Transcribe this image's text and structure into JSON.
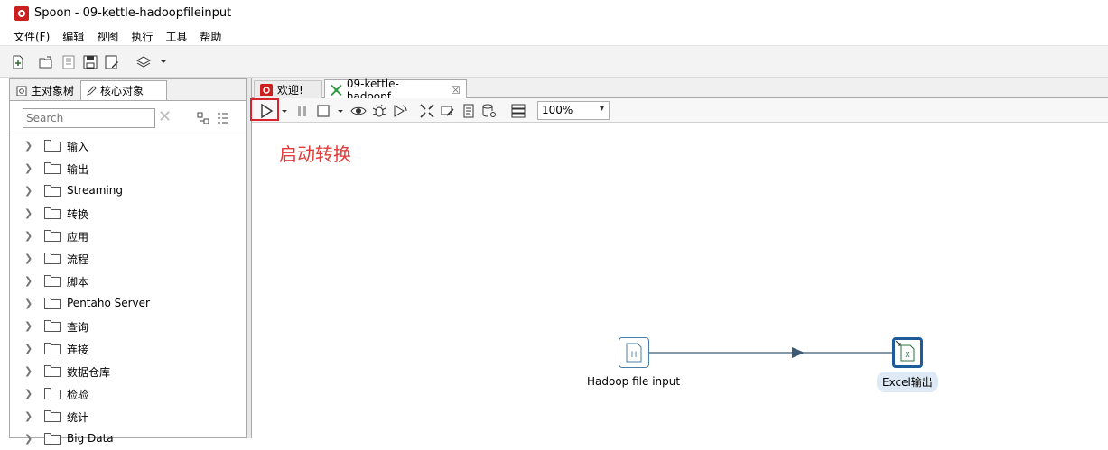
{
  "window": {
    "title": "Spoon - 09-kettle-hadoopfileinput"
  },
  "menu": [
    "文件(F)",
    "编辑",
    "视图",
    "执行",
    "工具",
    "帮助"
  ],
  "left_panel": {
    "tabs": [
      {
        "label": "主对象树",
        "icon": "search-icon"
      },
      {
        "label": "核心对象",
        "icon": "pencil-icon"
      }
    ],
    "search_placeholder": "Search",
    "tree": [
      "输入",
      "输出",
      "Streaming",
      "转换",
      "应用",
      "流程",
      "脚本",
      "Pentaho Server",
      "查询",
      "连接",
      "数据仓库",
      "检验",
      "统计",
      "Big Data"
    ]
  },
  "editor": {
    "tabs": [
      {
        "label": "欢迎!",
        "icon": "spoon-icon"
      },
      {
        "label": "09-kettle-hadoopf...",
        "icon": "transformation-icon",
        "close": "☒"
      }
    ],
    "zoom": "100%",
    "annotation": "启动转换",
    "steps": [
      {
        "name": "Hadoop file input",
        "glyph": "H"
      },
      {
        "name": "Excel输出",
        "glyph": "X"
      }
    ]
  },
  "colors": {
    "annotation": "#e23a3a",
    "highlight": "#d9232d",
    "step_border": "#1f5b98",
    "hop": "#3c5a73"
  }
}
